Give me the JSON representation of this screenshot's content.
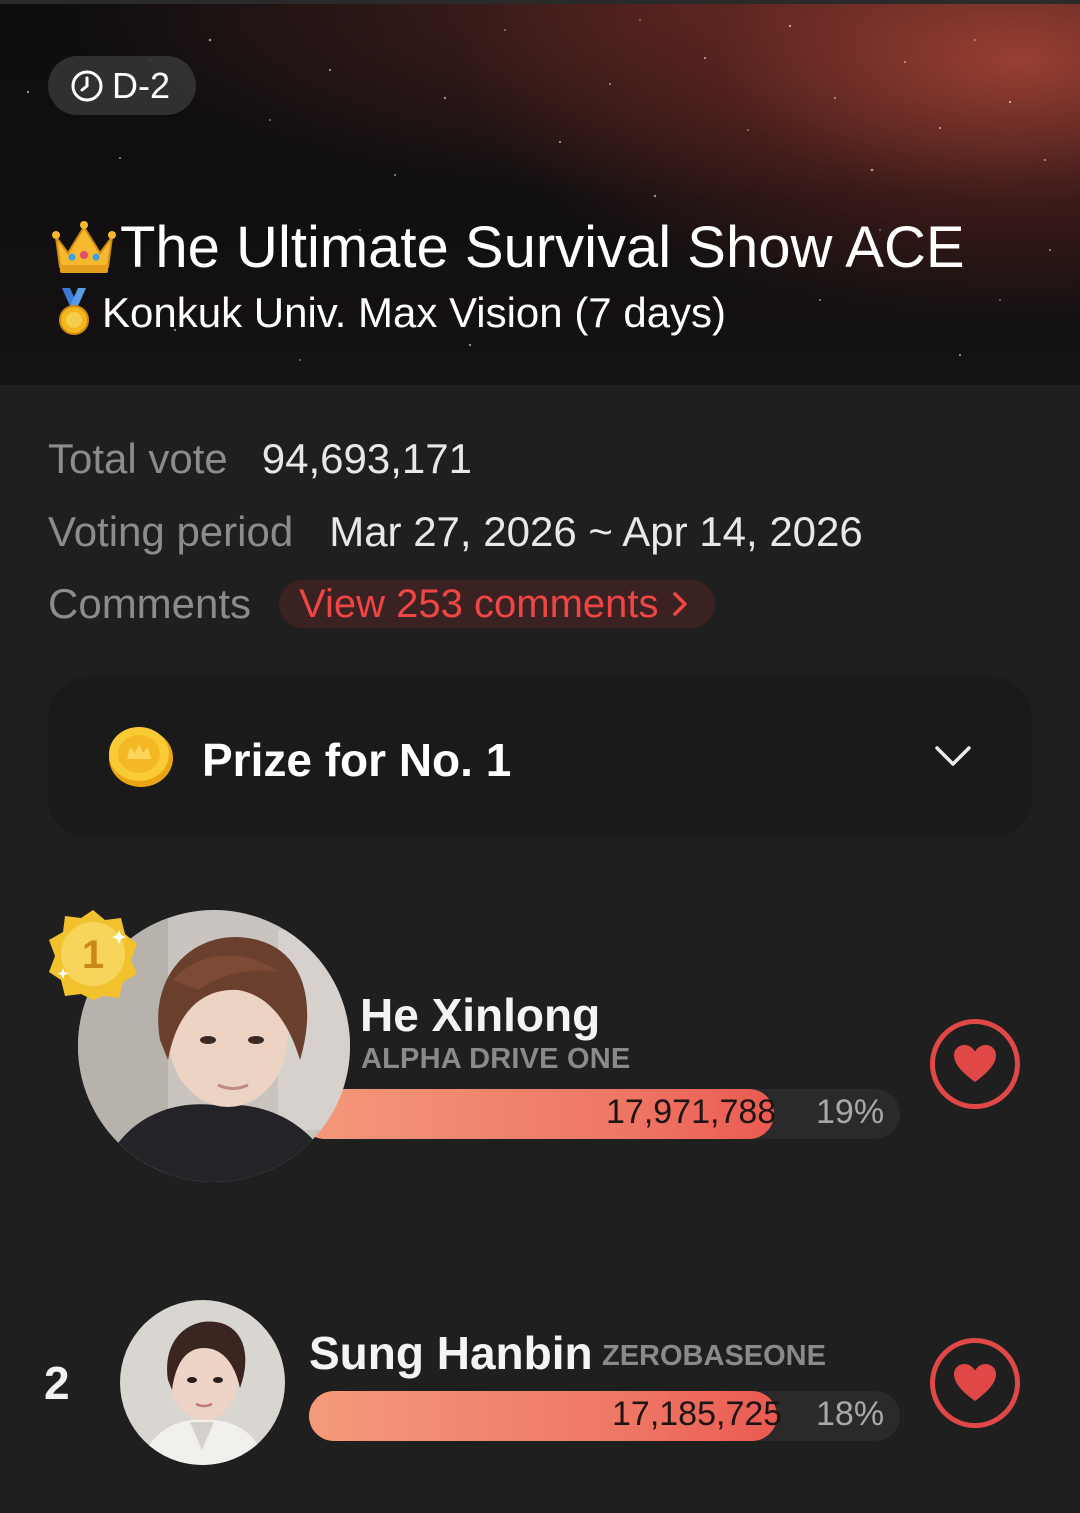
{
  "hero": {
    "deadline_badge": "D-2",
    "title": "The Ultimate Survival Show ACE",
    "subtitle": "Konkuk Univ. Max Vision (7 days)"
  },
  "info": {
    "total_vote_label": "Total vote",
    "total_vote_value": "94,693,171",
    "voting_period_label": "Voting period",
    "voting_period_value": "Mar 27, 2026 ~ Apr 14, 2026",
    "comments_label": "Comments",
    "comments_link": "View 253 comments"
  },
  "prize": {
    "title": "Prize for No. 1"
  },
  "ranking": [
    {
      "rank": "1",
      "name": "He Xinlong",
      "group": "ALPHA DRIVE ONE",
      "votes": "17,971,788",
      "percent": "19%",
      "bar_fill_fraction": 0.19
    },
    {
      "rank": "2",
      "name": "Sung Hanbin",
      "group": "ZEROBASEONE",
      "votes": "17,185,725",
      "percent": "18%",
      "bar_fill_fraction": 0.18
    }
  ],
  "colors": {
    "accent_red": "#e04848",
    "bar_gradient_start": "#f49a7b",
    "bar_gradient_end": "#ea5a52",
    "background": "#1f1f1f"
  },
  "icons": {
    "deadline": "clock-icon",
    "title": "crown-emoji-icon",
    "subtitle": "medal-emoji-icon",
    "prize": "coin-icon",
    "expand": "chevron-down-icon",
    "vote": "heart-icon",
    "rank1": "gold-rank-badge-icon"
  }
}
